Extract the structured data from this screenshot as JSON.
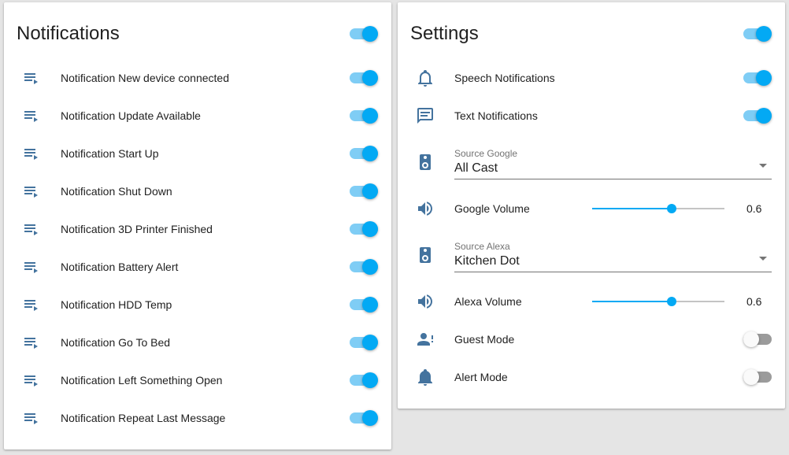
{
  "colors": {
    "accent": "#03a9f4",
    "icon": "#44739e",
    "track_on": "#7fcdf5",
    "track_off": "#9b9b9b"
  },
  "notifications": {
    "title": "Notifications",
    "master_toggle_on": true,
    "items": [
      {
        "label": "Notification New device connected",
        "icon": "playlist-play-icon",
        "on": true
      },
      {
        "label": "Notification Update Available",
        "icon": "playlist-play-icon",
        "on": true
      },
      {
        "label": "Notification Start Up",
        "icon": "playlist-play-icon",
        "on": true
      },
      {
        "label": "Notification Shut Down",
        "icon": "playlist-play-icon",
        "on": true
      },
      {
        "label": "Notification 3D Printer Finished",
        "icon": "playlist-play-icon",
        "on": true
      },
      {
        "label": "Notification Battery Alert",
        "icon": "playlist-play-icon",
        "on": true
      },
      {
        "label": "Notification HDD Temp",
        "icon": "playlist-play-icon",
        "on": true
      },
      {
        "label": "Notification Go To Bed",
        "icon": "playlist-play-icon",
        "on": true
      },
      {
        "label": "Notification Left Something Open",
        "icon": "playlist-play-icon",
        "on": true
      },
      {
        "label": "Notification Repeat Last Message",
        "icon": "playlist-play-icon",
        "on": true
      }
    ]
  },
  "settings": {
    "title": "Settings",
    "master_toggle_on": true,
    "speech": {
      "label": "Speech Notifications",
      "icon": "bell-outline-icon",
      "on": true
    },
    "text": {
      "label": "Text Notifications",
      "icon": "message-text-icon",
      "on": true
    },
    "source_google": {
      "label": "Source Google",
      "value": "All Cast",
      "icon": "speaker-icon"
    },
    "google_volume": {
      "label": "Google Volume",
      "value": 0.6,
      "display": "0.6",
      "min": 0,
      "max": 1,
      "icon": "volume-icon"
    },
    "source_alexa": {
      "label": "Source Alexa",
      "value": "Kitchen Dot",
      "icon": "speaker-icon"
    },
    "alexa_volume": {
      "label": "Alexa Volume",
      "value": 0.6,
      "display": "0.6",
      "min": 0,
      "max": 1,
      "icon": "volume-icon"
    },
    "guest_mode": {
      "label": "Guest Mode",
      "icon": "account-alert-icon",
      "on": false
    },
    "alert_mode": {
      "label": "Alert Mode",
      "icon": "bell-icon",
      "on": false
    }
  }
}
